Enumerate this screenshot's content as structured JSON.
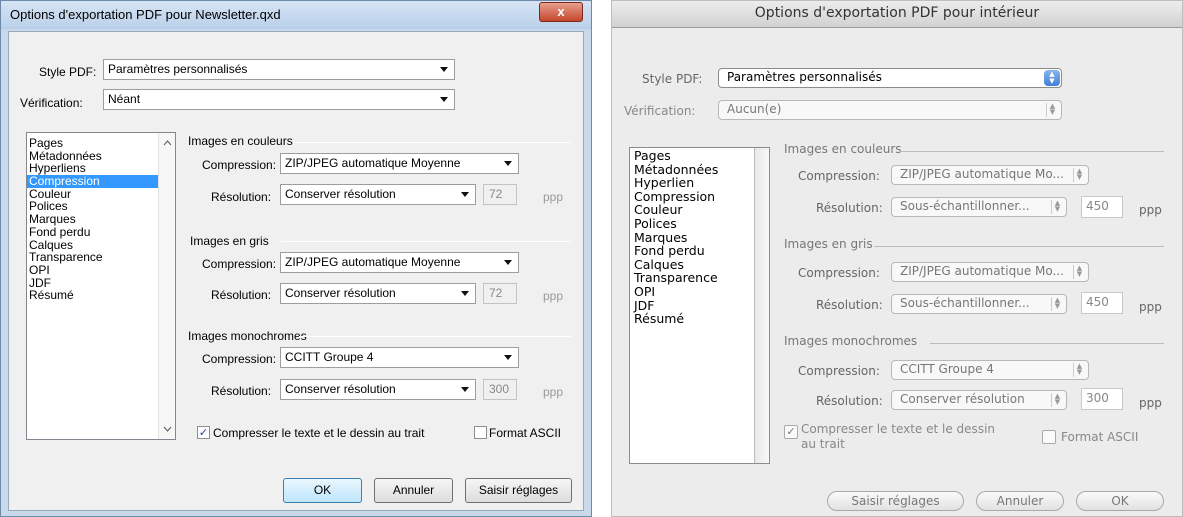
{
  "windows_dialog": {
    "title": "Options d'exportation PDF pour Newsletter.qxd",
    "close_glyph": "x",
    "style_label": "Style PDF:",
    "style_value": "Paramètres personnalisés",
    "verification_label": "Vérification:",
    "verification_value": "Néant",
    "nav_items": [
      "Pages",
      "Métadonnées",
      "Hyperliens",
      "Compression",
      "Couleur",
      "Polices",
      "Marques",
      "Fond perdu",
      "Calques",
      "Transparence",
      "OPI",
      "JDF",
      "Résumé"
    ],
    "selected_nav": "Compression",
    "groups": [
      {
        "title": "Images en couleurs",
        "compression_label": "Compression:",
        "compression_value": "ZIP/JPEG automatique Moyenne",
        "resolution_label": "Résolution:",
        "resolution_value": "Conserver résolution",
        "number": "72",
        "unit": "ppp"
      },
      {
        "title": "Images en gris",
        "compression_label": "Compression:",
        "compression_value": "ZIP/JPEG automatique Moyenne",
        "resolution_label": "Résolution:",
        "resolution_value": "Conserver résolution",
        "number": "72",
        "unit": "ppp"
      },
      {
        "title": "Images monochromes",
        "compression_label": "Compression:",
        "compression_value": "CCITT Groupe 4",
        "resolution_label": "Résolution:",
        "resolution_value": "Conserver résolution",
        "number": "300",
        "unit": "ppp"
      }
    ],
    "compress_text_label": "Compresser le texte et le dessin au trait",
    "compress_text_checked": true,
    "ascii_label": "Format ASCII",
    "ascii_checked": false,
    "buttons": {
      "ok": "OK",
      "cancel": "Annuler",
      "capture": "Saisir réglages"
    }
  },
  "mac_dialog": {
    "title": "Options d'exportation PDF pour intérieur",
    "style_label": "Style PDF:",
    "style_value": "Paramètres personnalisés",
    "verification_label": "Vérification:",
    "verification_value": "Aucun(e)",
    "nav_items": [
      "Pages",
      "Métadonnées",
      "Hyperlien",
      "Compression",
      "Couleur",
      "Polices",
      "Marques",
      "Fond perdu",
      "Calques",
      "Transparence",
      "OPI",
      "JDF",
      "Résumé"
    ],
    "groups": [
      {
        "title": "Images en couleurs",
        "compression_label": "Compression:",
        "compression_value": "ZIP/JPEG automatique Mo...",
        "resolution_label": "Résolution:",
        "resolution_value": "Sous-échantillonner...",
        "number": "450",
        "unit": "ppp"
      },
      {
        "title": "Images en gris",
        "compression_label": "Compression:",
        "compression_value": "ZIP/JPEG automatique Mo...",
        "resolution_label": "Résolution:",
        "resolution_value": "Sous-échantillonner...",
        "number": "450",
        "unit": "ppp"
      },
      {
        "title": "Images monochromes",
        "compression_label": "Compression:",
        "compression_value": "CCITT Groupe 4",
        "resolution_label": "Résolution:",
        "resolution_value": "Conserver résolution",
        "number": "300",
        "unit": "ppp"
      }
    ],
    "compress_text_line1": "Compresser le texte et le dessin",
    "compress_text_line2": "au trait",
    "compress_text_checked": true,
    "ascii_label": "Format ASCII",
    "ascii_checked": false,
    "buttons": {
      "capture": "Saisir réglages",
      "cancel": "Annuler",
      "ok": "OK"
    }
  },
  "colors": {
    "win_selection": "#3399ff",
    "win_frame": "#c9d9ec",
    "mac_accent": "#3f7fd7"
  }
}
